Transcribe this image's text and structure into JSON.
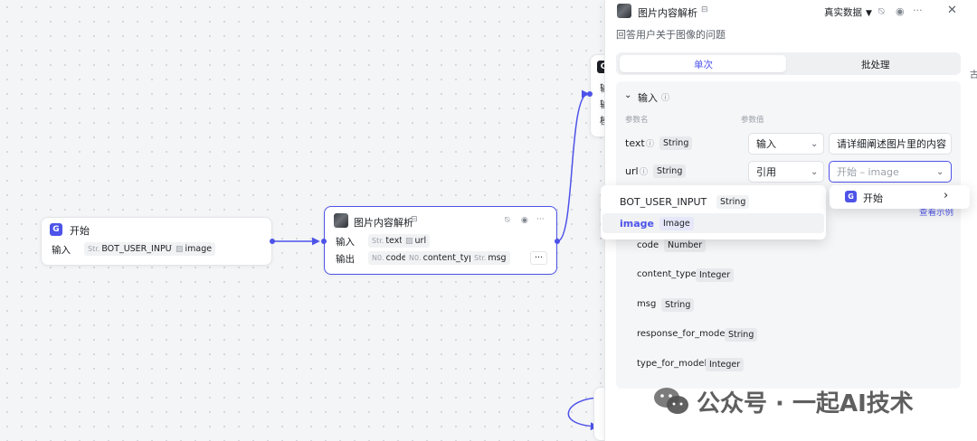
{
  "canvas": {
    "start_node": {
      "title": "开始",
      "input_label": "输入",
      "tags": [
        {
          "prefix": "Str.",
          "name": "BOT_USER_INPUT"
        },
        {
          "prefix": "img",
          "name": "image"
        }
      ]
    },
    "image_node": {
      "title": "图片内容解析",
      "input_label": "输入",
      "output_label": "输出",
      "inputs": [
        {
          "prefix": "Str.",
          "name": "text"
        },
        {
          "prefix": "img",
          "name": "url"
        }
      ],
      "outputs": [
        {
          "prefix": "N0.",
          "name": "code"
        },
        {
          "prefix": "N0.",
          "name": "content_type"
        },
        {
          "prefix": "Str.",
          "name": "msg"
        }
      ],
      "more": "···"
    },
    "partial_node": {
      "lines": [
        "输",
        "输",
        "模"
      ]
    }
  },
  "panel": {
    "title": "图片内容解析",
    "description": "回答用户关于图像的问题",
    "data_mode": "真实数据",
    "tabs": [
      "单次",
      "批处理"
    ],
    "input_section": {
      "title": "输入",
      "col_name": "参数名",
      "col_value": "参数值",
      "params": [
        {
          "name": "text",
          "type": "String",
          "mode": "输入",
          "value": "请详细阐述图片里的内容"
        },
        {
          "name": "url",
          "type": "String",
          "mode": "引用",
          "value": "开始 – image"
        }
      ]
    },
    "view_example": "查看示例",
    "outputs": [
      {
        "name": "code",
        "type": "Number"
      },
      {
        "name": "content_type",
        "type": "Integer"
      },
      {
        "name": "msg",
        "type": "String"
      },
      {
        "name": "response_for_model",
        "type": "String"
      },
      {
        "name": "type_for_model",
        "type": "Integer"
      }
    ]
  },
  "dropdown": {
    "items": [
      {
        "name": "BOT_USER_INPUT",
        "type": "String"
      },
      {
        "name": "image",
        "type": "Image"
      }
    ]
  },
  "submenu": {
    "label": "开始"
  },
  "watermark": {
    "text": "公众号 · 一起AI技术"
  },
  "colors": {
    "accent": "#4d53e8",
    "canvas_bg": "#f4f5f7"
  }
}
